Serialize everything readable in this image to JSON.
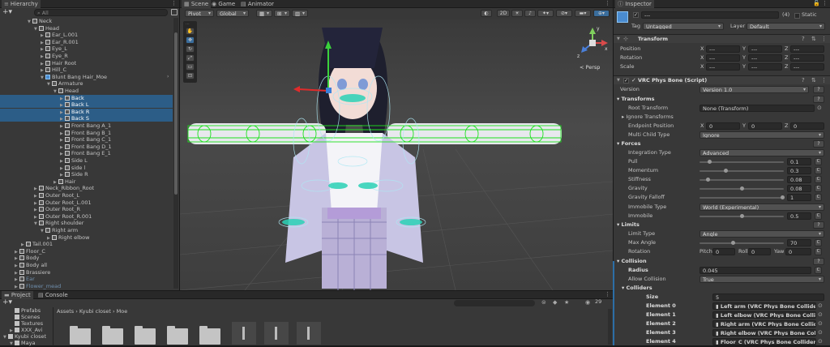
{
  "hierarchy": {
    "tab": "Hierarchy",
    "search_placeholder": "All",
    "rows": [
      {
        "label": "Neck",
        "indent": 4,
        "expanded": true,
        "sel": false,
        "icon": "cube",
        "dim": false
      },
      {
        "label": "Head",
        "indent": 5,
        "expanded": true,
        "sel": false,
        "icon": "cube",
        "dim": false
      },
      {
        "label": "Ear_L.001",
        "indent": 6,
        "expanded": false,
        "sel": false,
        "icon": "cube",
        "dim": false
      },
      {
        "label": "Ear_R.001",
        "indent": 6,
        "expanded": false,
        "sel": false,
        "icon": "cube",
        "dim": false
      },
      {
        "label": "Eye_L",
        "indent": 6,
        "expanded": false,
        "sel": false,
        "icon": "cube",
        "dim": false
      },
      {
        "label": "Eye_R",
        "indent": 6,
        "expanded": false,
        "sel": false,
        "icon": "cube",
        "dim": false
      },
      {
        "label": "Hair Root",
        "indent": 6,
        "expanded": false,
        "sel": false,
        "icon": "cube",
        "dim": false
      },
      {
        "label": "Hill_C",
        "indent": 6,
        "expanded": false,
        "sel": false,
        "icon": "cube",
        "dim": false
      },
      {
        "label": "Blunt Bang Hair_Moe",
        "indent": 6,
        "expanded": true,
        "sel": false,
        "icon": "blue",
        "dim": false
      },
      {
        "label": "Armature",
        "indent": 7,
        "expanded": true,
        "sel": false,
        "icon": "cube",
        "dim": false
      },
      {
        "label": "Head",
        "indent": 8,
        "expanded": true,
        "sel": false,
        "icon": "cube",
        "dim": false
      },
      {
        "label": "Back",
        "indent": 9,
        "expanded": false,
        "sel": true,
        "icon": "cube",
        "dim": false
      },
      {
        "label": "Back L",
        "indent": 9,
        "expanded": false,
        "sel": true,
        "icon": "cube",
        "dim": false
      },
      {
        "label": "Back R",
        "indent": 9,
        "expanded": false,
        "sel": true,
        "icon": "cube",
        "dim": false
      },
      {
        "label": "Back S",
        "indent": 9,
        "expanded": false,
        "sel": true,
        "icon": "cube",
        "dim": false
      },
      {
        "label": "Front Bang A_1",
        "indent": 9,
        "expanded": false,
        "sel": false,
        "icon": "cube",
        "dim": false
      },
      {
        "label": "Front Bang B_1",
        "indent": 9,
        "expanded": false,
        "sel": false,
        "icon": "cube",
        "dim": false
      },
      {
        "label": "Front Bang C_1",
        "indent": 9,
        "expanded": false,
        "sel": false,
        "icon": "cube",
        "dim": false
      },
      {
        "label": "Front Bang D_1",
        "indent": 9,
        "expanded": false,
        "sel": false,
        "icon": "cube",
        "dim": false
      },
      {
        "label": "Front Bang E_1",
        "indent": 9,
        "expanded": false,
        "sel": false,
        "icon": "cube",
        "dim": false
      },
      {
        "label": "Side L",
        "indent": 9,
        "expanded": false,
        "sel": false,
        "icon": "cube",
        "dim": false
      },
      {
        "label": "side l",
        "indent": 9,
        "expanded": false,
        "sel": false,
        "icon": "cube",
        "dim": false
      },
      {
        "label": "Side R",
        "indent": 9,
        "expanded": false,
        "sel": false,
        "icon": "cube",
        "dim": false
      },
      {
        "label": "Hair",
        "indent": 8,
        "expanded": false,
        "sel": false,
        "icon": "cube",
        "dim": false
      },
      {
        "label": "Neck_Ribbon_Root",
        "indent": 5,
        "expanded": false,
        "sel": false,
        "icon": "cube",
        "dim": false
      },
      {
        "label": "Outer Root_L",
        "indent": 5,
        "expanded": false,
        "sel": false,
        "icon": "cube",
        "dim": false
      },
      {
        "label": "Outer Root_L.001",
        "indent": 5,
        "expanded": false,
        "sel": false,
        "icon": "cube",
        "dim": false
      },
      {
        "label": "Outer Root_R",
        "indent": 5,
        "expanded": false,
        "sel": false,
        "icon": "cube",
        "dim": false
      },
      {
        "label": "Outer Root_R.001",
        "indent": 5,
        "expanded": false,
        "sel": false,
        "icon": "cube",
        "dim": false
      },
      {
        "label": "Right shoulder",
        "indent": 5,
        "expanded": true,
        "sel": false,
        "icon": "cube",
        "dim": false
      },
      {
        "label": "Right arm",
        "indent": 6,
        "expanded": true,
        "sel": false,
        "icon": "cube",
        "dim": false
      },
      {
        "label": "Right elbow",
        "indent": 7,
        "expanded": false,
        "sel": false,
        "icon": "cube",
        "dim": false
      },
      {
        "label": "Tail.001",
        "indent": 3,
        "expanded": false,
        "sel": false,
        "icon": "cube",
        "dim": false
      },
      {
        "label": "Floor_C",
        "indent": 2,
        "expanded": false,
        "sel": false,
        "icon": "cube",
        "dim": false
      },
      {
        "label": "Body",
        "indent": 2,
        "expanded": false,
        "sel": false,
        "icon": "cube",
        "dim": false
      },
      {
        "label": "Body all",
        "indent": 2,
        "expanded": false,
        "sel": false,
        "icon": "cube",
        "dim": false
      },
      {
        "label": "Brassiere",
        "indent": 2,
        "expanded": false,
        "sel": false,
        "icon": "cube",
        "dim": false
      },
      {
        "label": "Ear",
        "indent": 2,
        "expanded": false,
        "sel": false,
        "icon": "cube",
        "dim": true
      },
      {
        "label": "Flower_mead",
        "indent": 2,
        "expanded": false,
        "sel": false,
        "icon": "cube",
        "dim": true
      }
    ]
  },
  "scene": {
    "tabs": [
      "Scene",
      "Game",
      "Animator"
    ],
    "pivot": "Pivot",
    "global": "Global",
    "mode_2d": "2D",
    "persp": "< Persp",
    "axis_x": "x",
    "axis_y": "y",
    "axis_z": "z"
  },
  "inspector": {
    "tab": "Inspector",
    "object_name": "---",
    "layer_count": "(4)",
    "static_label": "Static",
    "tag_label": "Tag",
    "tag_value": "Untagged",
    "layer_label": "Layer",
    "layer_value": "Default",
    "transform_title": "Transform",
    "position_label": "Position",
    "rotation_label": "Rotation",
    "scale_label": "Scale",
    "x": "X",
    "y": "Y",
    "z": "Z",
    "dash": "---",
    "component_title": "VRC Phys Bone (Script)",
    "version_label": "Version",
    "version_value": "Version 1.0",
    "q": "?",
    "transforms_header": "Transforms",
    "root_transform_label": "Root Transform",
    "root_transform_value": "None (Transform)",
    "ignore_transforms_label": "Ignore Transforms",
    "endpoint_label": "Endpoint Position",
    "endpoint_x": "0",
    "endpoint_y": "0",
    "endpoint_z": "0",
    "multi_child_label": "Multi Child Type",
    "multi_child_value": "Ignore",
    "forces_header": "Forces",
    "integration_label": "Integration Type",
    "integration_value": "Advanced",
    "force_rows": [
      {
        "label": "Pull",
        "value": "0.1",
        "level": 0.1
      },
      {
        "label": "Momentum",
        "value": "0.3",
        "level": 0.3
      },
      {
        "label": "Stiffness",
        "value": "0.08",
        "level": 0.08
      },
      {
        "label": "Gravity",
        "value": "0.08",
        "level": 0.5
      },
      {
        "label": "Gravity Falloff",
        "value": "1",
        "level": 1
      }
    ],
    "immobile_type_label": "Immobile Type",
    "immobile_type_value": "World (Experimental)",
    "immobile_label": "Immobile",
    "immobile_value": "0.5",
    "immobile_level": 0.5,
    "limits_header": "Limits",
    "limit_type_label": "Limit Type",
    "limit_type_value": "Angle",
    "max_angle_label": "Max Angle",
    "max_angle_value": "70",
    "max_angle_level": 0.39,
    "rotation_row_label": "Rotation",
    "pitch_label": "Pitch",
    "pitch_value": "0",
    "roll_label": "Roll",
    "roll_value": "0",
    "yaw_label": "Yaw",
    "yaw_value": "0",
    "collision_header": "Collision",
    "radius_label": "Radius",
    "radius_value": "0.045",
    "allow_collision_label": "Allow Collision",
    "allow_collision_value": "True",
    "colliders_header": "Colliders",
    "size_label": "Size",
    "size_value": "5",
    "c_label": "C",
    "colliders": [
      {
        "label": "Element 0",
        "value": "Left arm (VRC Phys Bone Collider)"
      },
      {
        "label": "Element 1",
        "value": "Left elbow (VRC Phys Bone Collider)"
      },
      {
        "label": "Element 2",
        "value": "Right arm (VRC Phys Bone Collider)"
      },
      {
        "label": "Element 3",
        "value": "Right elbow (VRC Phys Bone Collider)"
      },
      {
        "label": "Element 4",
        "value": "Floor_C (VRC Phys Bone Collider)"
      }
    ]
  },
  "project": {
    "tabs": [
      "Project",
      "Console"
    ],
    "breadcrumb": [
      "Assets",
      "Kyubi closet",
      "Moe"
    ],
    "item_count": "29",
    "tree": [
      "Prefabs",
      "Scenes",
      "Textures",
      "XXX_Avi",
      "Kyubi closet",
      "Maya"
    ]
  }
}
